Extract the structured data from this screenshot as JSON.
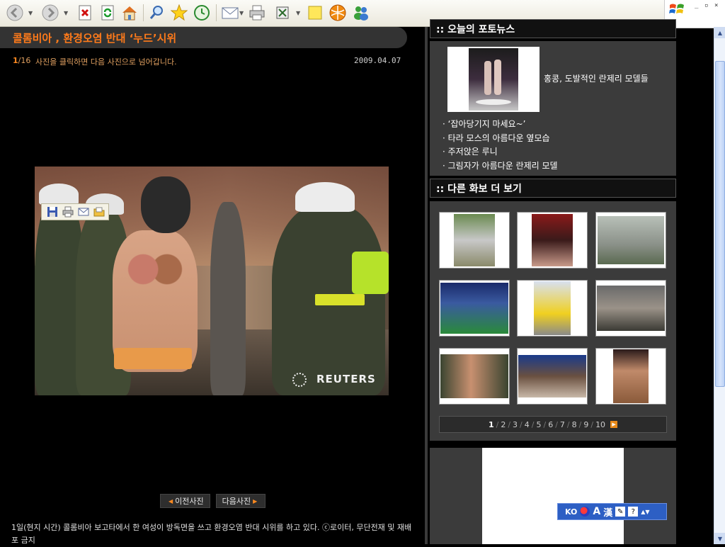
{
  "window": {
    "controls": {
      "minimize": "_",
      "restore": "▫",
      "close": "×"
    }
  },
  "toolbar": {
    "icons": [
      "back-icon",
      "forward-icon",
      "stop-icon",
      "refresh-icon",
      "home-icon",
      "search-icon",
      "favorites-icon",
      "history-icon",
      "mail-icon",
      "print-icon",
      "edit-icon",
      "notes-icon",
      "research-icon",
      "messenger-icon"
    ]
  },
  "article": {
    "title": "콜롬비아 , 환경오염 반대 ‘누드’시위",
    "counter_current": "1",
    "counter_total": "/16",
    "hint": "사진을 클릭하면 다음 사진으로 넘어갑니다.",
    "date": "2009.04.07",
    "watermark": "REUTERS",
    "prev_label": "이전사진",
    "next_label": "다음사진",
    "caption": "1일(현지 시간) 콜롬비아 보고타에서 한 여성이 방독면을 쓰고 환경오염 반대 시위를 하고 있다. ⓒ로이터, 무단전재 및 재배포 금지"
  },
  "today_photo": {
    "header": ":: 오늘의 포토뉴스",
    "featured_title": "홍콩, 도발적인 란제리 모델들",
    "items": [
      "· ‘잡아당기지 마세요~’",
      "· 타라 모스의 아름다운 옆모습",
      "· 주저앉은 루니",
      "· 그림자가 아름다운 란제리 모델"
    ]
  },
  "more_gallery": {
    "header": ":: 다른 화보 더 보기",
    "pages": [
      "1",
      "2",
      "3",
      "4",
      "5",
      "6",
      "7",
      "8",
      "9",
      "10"
    ],
    "current_page": "1"
  },
  "ime": {
    "lang": "KO",
    "mode": "A",
    "hanja": "漢"
  },
  "colors": {
    "accent": "#ff7a1a",
    "panel": "#3b3b3b",
    "background": "#000000"
  }
}
